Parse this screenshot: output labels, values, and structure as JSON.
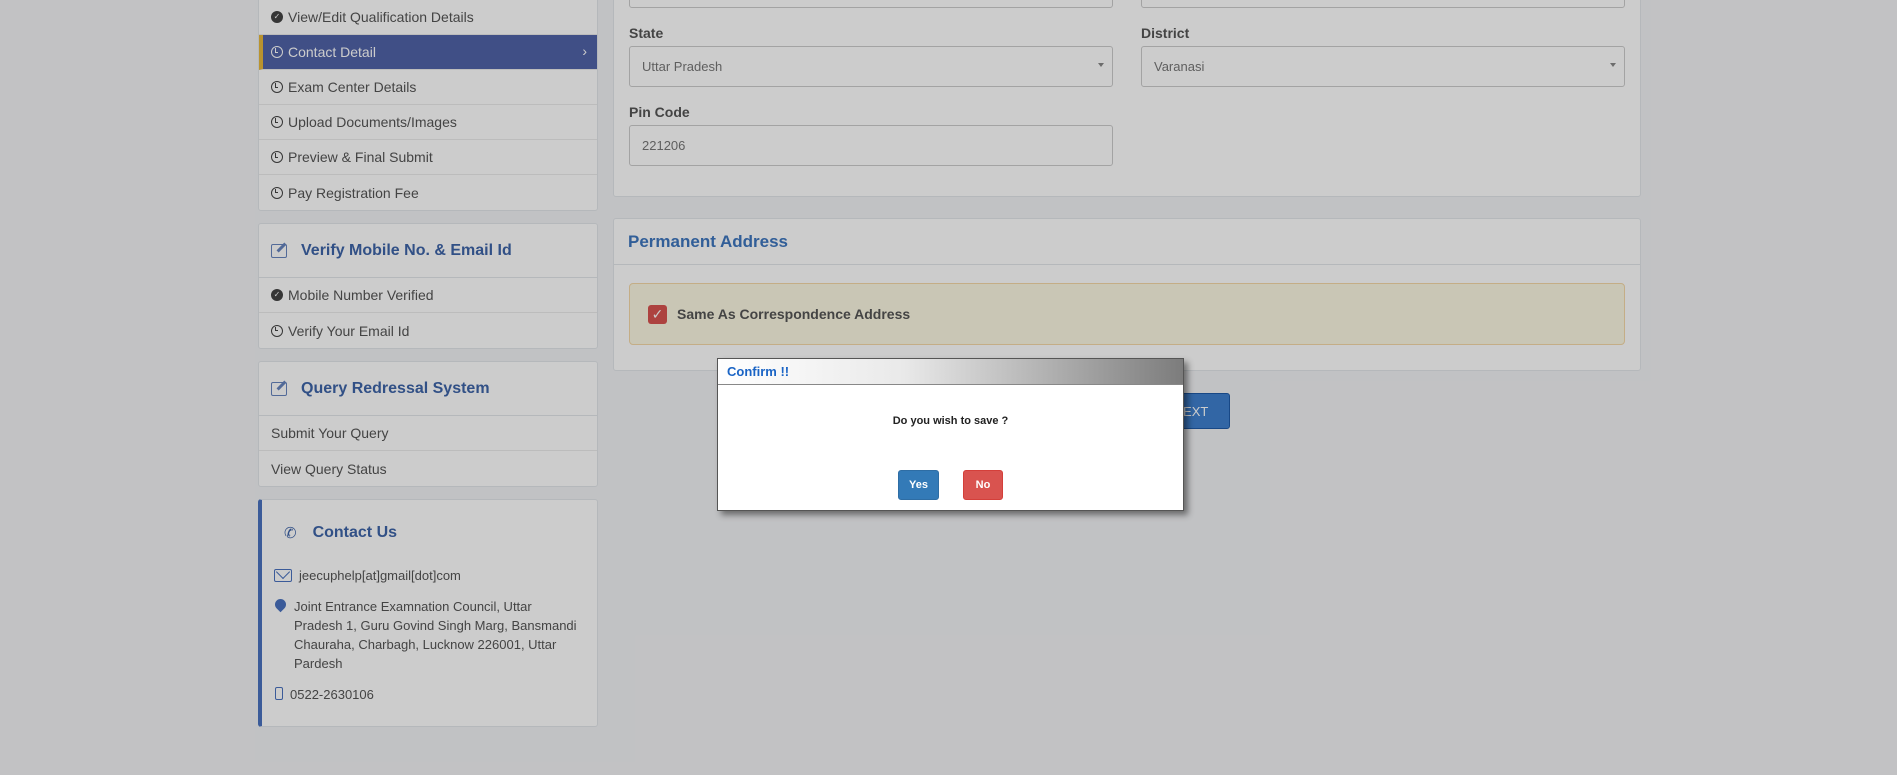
{
  "sidebar": {
    "menu": [
      {
        "label": "View/Edit Qualification Details",
        "icon": "check-circle-icon"
      },
      {
        "label": "Contact Detail",
        "icon": "clock-icon",
        "active": true
      },
      {
        "label": "Exam Center Details",
        "icon": "clock-icon"
      },
      {
        "label": "Upload Documents/Images",
        "icon": "clock-icon"
      },
      {
        "label": "Preview & Final Submit",
        "icon": "clock-icon"
      },
      {
        "label": "Pay Registration Fee",
        "icon": "clock-icon"
      }
    ],
    "verify": {
      "title": "Verify Mobile No. & Email Id",
      "items": [
        {
          "label": "Mobile Number Verified",
          "icon": "check-circle-icon"
        },
        {
          "label": "Verify Your Email Id",
          "icon": "clock-icon"
        }
      ]
    },
    "query": {
      "title": "Query Redressal System",
      "items": [
        {
          "label": "Submit Your Query"
        },
        {
          "label": "View Query Status"
        }
      ]
    },
    "contact": {
      "title": "Contact Us",
      "email": "jeecuphelp[at]gmail[dot]com",
      "address": "Joint Entrance Examnation Council, Uttar Pradesh 1, Guru Govind Singh Marg, Bansmandi Chauraha, Charbagh, Lucknow 226001, Uttar Pardesh",
      "phone": "0522-2630106"
    }
  },
  "form": {
    "state_label": "State",
    "state_value": "Uttar Pradesh",
    "district_label": "District",
    "district_value": "Varanasi",
    "pin_label": "Pin Code",
    "pin_value": "221206"
  },
  "permanent": {
    "title": "Permanent Address",
    "same_label": "Same As Correspondence Address",
    "same_checked": true
  },
  "next_button": "NEXT",
  "dialog": {
    "title": "Confirm !!",
    "message": "Do you wish to save ?",
    "yes_label": "Yes",
    "no_label": "No"
  },
  "colors": {
    "active_menu": "#5163a8",
    "accent": "#3e64a8",
    "yes_button": "#337ab7",
    "no_button": "#d9534f"
  }
}
